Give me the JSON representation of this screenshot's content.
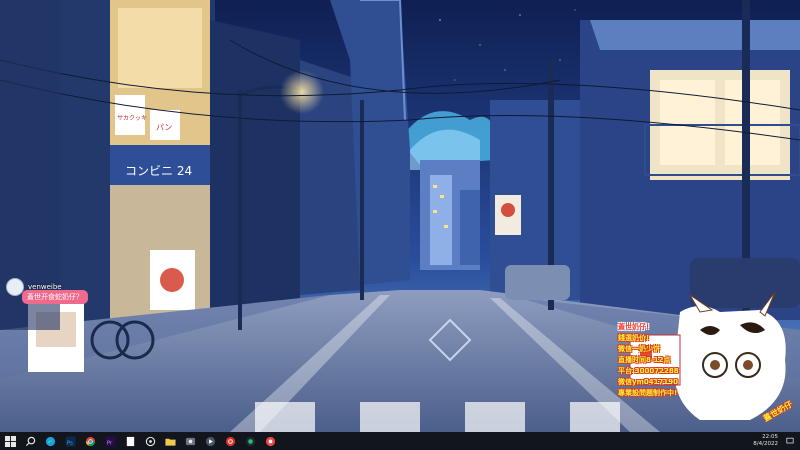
{
  "desktop": {
    "wallpaper_signs": {
      "store_name": "コンビニ 24",
      "sign_left": "サカクッキ",
      "sign_right": "パン"
    }
  },
  "chat_overlay": {
    "username": "venweibe",
    "message": "蓋世开食蛇奶仔？"
  },
  "promo_overlay": {
    "title": "蓋世奶仔!",
    "lines": [
      "錢選奶价!",
      "微信一奶少饼",
      "直播时间8-12点",
      "平台:300072288",
      "微信ym0417190",
      "專業設問題制作中!"
    ],
    "signature": "蓋世奶仔"
  },
  "taskbar": {
    "icons": [
      "windows-start-icon",
      "search-icon",
      "edge-browser-icon",
      "photoshop-icon",
      "chrome-icon",
      "premiere-icon",
      "settings-icon",
      "file-explorer-icon",
      "app-icon",
      "game-icon",
      "media-player-icon",
      "netease-music-icon",
      "camera-icon",
      "screen-recorder-icon"
    ],
    "clock_time": "22:05",
    "clock_date": "8/4/2022"
  },
  "colors": {
    "sky": "#1d3b86",
    "street": "#6d7fa8",
    "taskbar": "#12151c",
    "chat_bubble": "#f06a8e",
    "promo_text": "#ffec3d"
  }
}
